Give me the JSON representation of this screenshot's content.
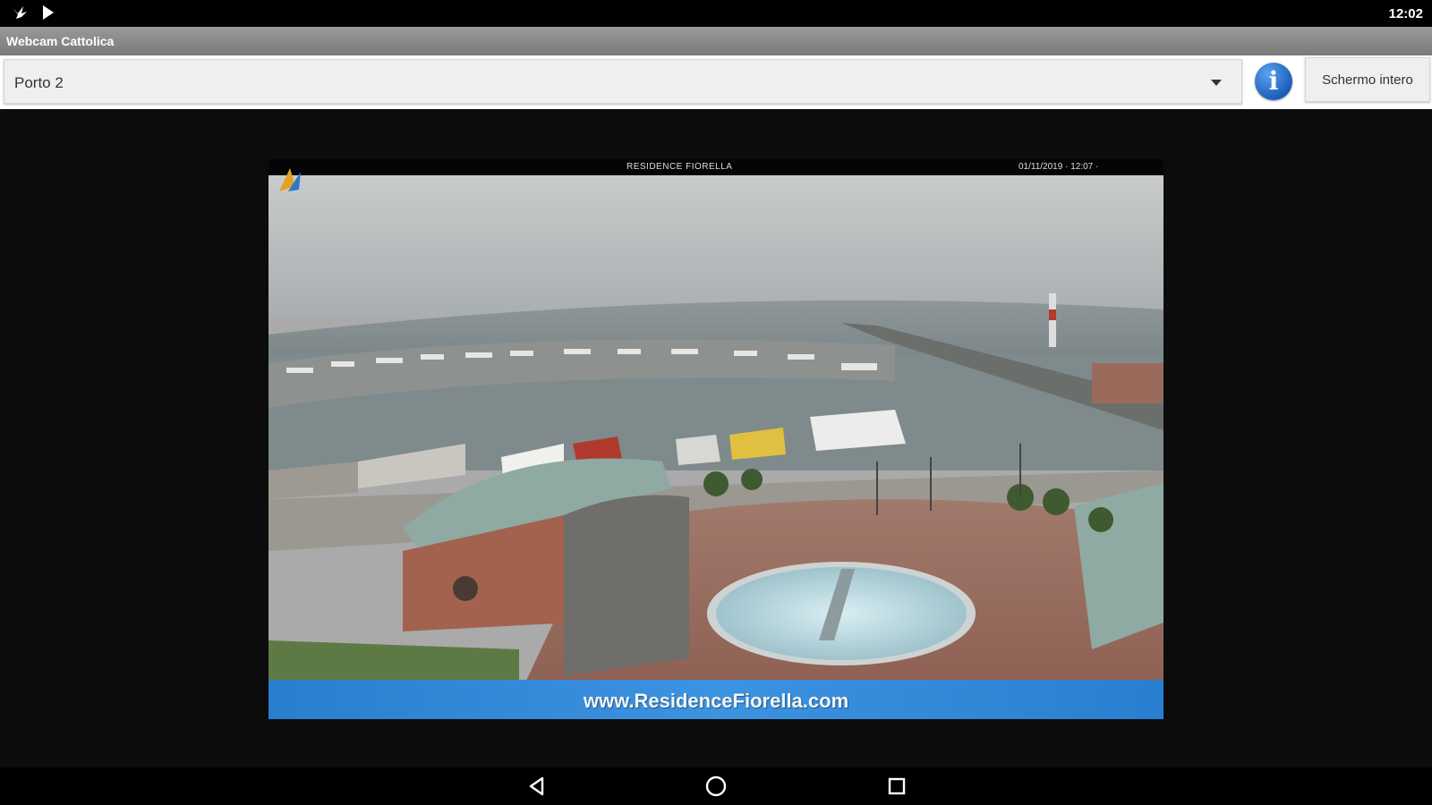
{
  "status_bar": {
    "time": "12:02",
    "icons": [
      "notification-bird-icon",
      "play-store-icon"
    ]
  },
  "app": {
    "title": "Webcam Cattolica"
  },
  "toolbar": {
    "selected_camera": "Porto 2",
    "fullscreen_label": "Schermo intero",
    "info_glyph": "i"
  },
  "webcam": {
    "caption": "RESIDENCE FIORELLA",
    "datetime": "01/11/2019 · 12:07 ·",
    "url": "www.ResidenceFiorella.com"
  },
  "nav_bar": {
    "icons": [
      "back-icon",
      "home-icon",
      "recents-icon"
    ]
  }
}
